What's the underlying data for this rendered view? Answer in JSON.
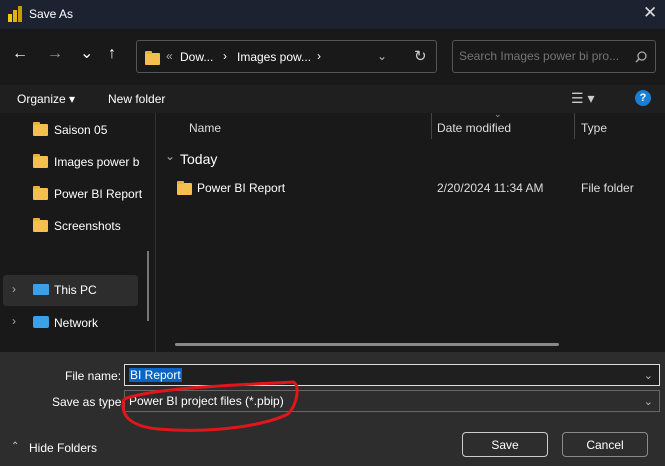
{
  "window": {
    "title": "Save As",
    "close_icon": "close-icon",
    "app_icon": "power-bi-icon"
  },
  "nav": {
    "back": "←",
    "forward": "→",
    "recent": "⌄",
    "up": "↑",
    "breadcrumb": {
      "overflow": "«",
      "items": [
        "Dow...",
        "Images pow..."
      ],
      "sep": "›"
    },
    "refresh": "↻",
    "search_placeholder": "Search Images power bi pro..."
  },
  "toolbar": {
    "organize": "Organize ▾",
    "new_folder": "New folder",
    "view": "☰ ▾",
    "help": "?"
  },
  "sidebar": {
    "items": [
      {
        "label": "Saison 05",
        "icon": "folder-icon"
      },
      {
        "label": "Images power b",
        "icon": "folder-icon"
      },
      {
        "label": "Power BI Report",
        "icon": "folder-icon"
      },
      {
        "label": "Screenshots",
        "icon": "folder-icon"
      },
      {
        "label": "This PC",
        "icon": "computer-icon",
        "selected": true
      },
      {
        "label": "Network",
        "icon": "network-icon"
      }
    ]
  },
  "list": {
    "columns": [
      "Name",
      "Date modified",
      "Type"
    ],
    "group": "Today",
    "rows": [
      {
        "name": "Power BI Report",
        "date": "2/20/2024 11:34 AM",
        "type": "File folder"
      }
    ]
  },
  "form": {
    "file_name_label": "File name:",
    "file_name": "BI Report",
    "type_label": "Save as type:",
    "type_value": "Power BI project files (*.pbip)",
    "annotation_color": "#e0161b"
  },
  "footer": {
    "hide_folders": "Hide Folders",
    "save": "Save",
    "cancel": "Cancel"
  }
}
